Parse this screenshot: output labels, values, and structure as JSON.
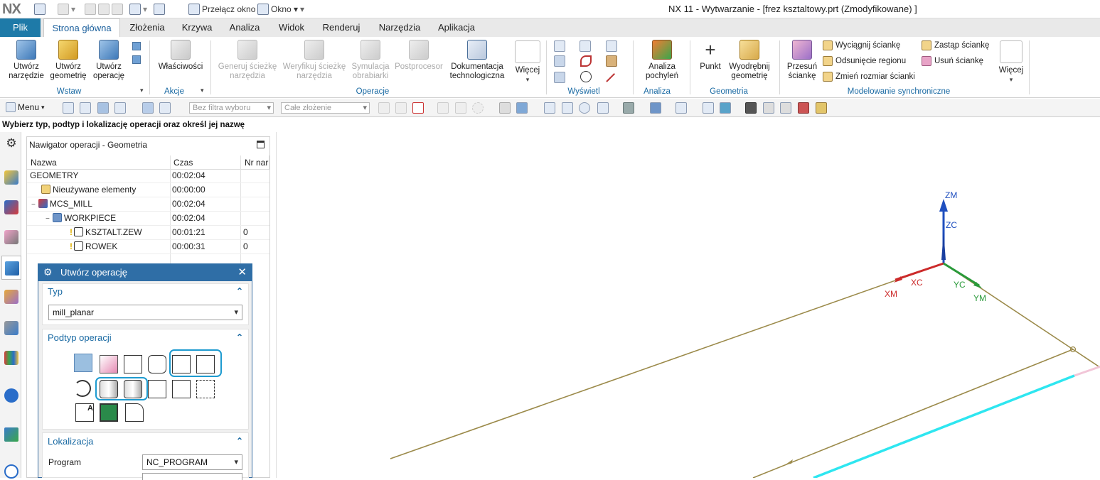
{
  "app": {
    "logo": "NX",
    "window_title": "NX 11 - Wytwarzanie - [frez ksztaltowy.prt (Zmodyfikowane) ]"
  },
  "quick_access": {
    "switch_window": "Przełącz okno",
    "window_menu": "Okno ▾"
  },
  "tabs": {
    "file": "Plik",
    "items": [
      "Strona główna",
      "Złożenia",
      "Krzywa",
      "Analiza",
      "Widok",
      "Renderuj",
      "Narzędzia",
      "Aplikacja"
    ],
    "active": "Strona główna"
  },
  "ribbon": {
    "insert": {
      "group": "Wstaw",
      "create_tool": "Utwórz narzędzie",
      "create_geometry": "Utwórz geometrię",
      "create_operation": "Utwórz operację"
    },
    "actions": {
      "group": "Akcje",
      "properties": "Właściwości"
    },
    "operations": {
      "group": "Operacje",
      "generate_path": "Generuj ścieżkę narzędzia",
      "verify_path": "Weryfikuj ścieżkę narzędzia",
      "simulate": "Symulacja obrabiarki",
      "postprocessor": "Postprocesor",
      "documentation": "Dokumentacja technologiczna",
      "more": "Więcej"
    },
    "display": {
      "group": "Wyświetl"
    },
    "analysis": {
      "group": "Analiza",
      "draft_analysis": "Analiza pochyleń"
    },
    "geometry": {
      "group": "Geometria",
      "point": "Punkt",
      "extract": "Wyodrębnij geometrię"
    },
    "sync": {
      "group": "Modelowanie synchroniczne",
      "move_face": "Przesuń ściankę",
      "pull_face": "Wyciągnij ściankę",
      "offset_region": "Odsunięcie regionu",
      "resize_face": "Zmień rozmiar ścianki",
      "replace_face": "Zastąp ściankę",
      "delete_face": "Usuń ściankę",
      "more": "Więcej"
    }
  },
  "toolbar": {
    "menu": "Menu",
    "filter": "Bez filtra wyboru",
    "assembly": "Całe złożenie"
  },
  "status": "Wybierz typ, podtyp i lokalizację operacji oraz określ jej nazwę",
  "navigator": {
    "title": "Nawigator operacji - Geometria",
    "columns": [
      "Nazwa",
      "Czas",
      "Nr nar"
    ],
    "rows": [
      {
        "name": "GEOMETRY",
        "time": "00:02:04",
        "tool": ""
      },
      {
        "name": "Nieużywane elementy",
        "time": "00:00:00",
        "tool": ""
      },
      {
        "name": "MCS_MILL",
        "time": "00:02:04",
        "tool": ""
      },
      {
        "name": "WORKPIECE",
        "time": "00:02:04",
        "tool": ""
      },
      {
        "name": "KSZTALT.ZEW",
        "time": "00:01:21",
        "tool": "0"
      },
      {
        "name": "ROWEK",
        "time": "00:00:31",
        "tool": "0"
      }
    ]
  },
  "dialog": {
    "title": "Utwórz operację",
    "type_section": "Typ",
    "type_value": "mill_planar",
    "subtype_section": "Podtyp operacji",
    "location_section": "Lokalizacja",
    "program_label": "Program",
    "program_value": "NC_PROGRAM"
  },
  "viewport": {
    "axes": [
      "ZM",
      "ZC",
      "XC",
      "XM",
      "YC",
      "YM"
    ]
  },
  "colors": {
    "accent": "#1e7aa8",
    "dialog_header": "#2f6ea6",
    "highlight": "#1e9bd0",
    "axis_z": "#1f4fbf",
    "axis_x": "#cc2a2a",
    "axis_y": "#2a9a3a",
    "edge": "#9b8a4a",
    "cyan_edge": "#2ee6f0"
  }
}
